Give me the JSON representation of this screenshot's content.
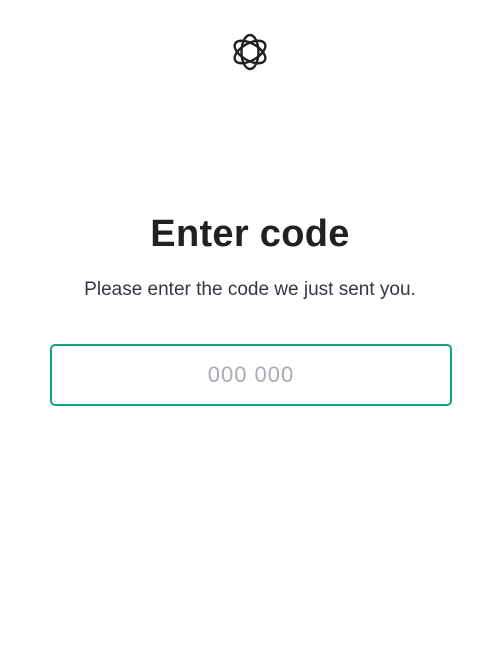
{
  "brand": {
    "logo_icon": "openai-logo-icon"
  },
  "page": {
    "title": "Enter code",
    "subtitle": "Please enter the code we just sent you."
  },
  "code_input": {
    "placeholder": "000 000",
    "value": "",
    "focus_color": "#10a37f"
  }
}
